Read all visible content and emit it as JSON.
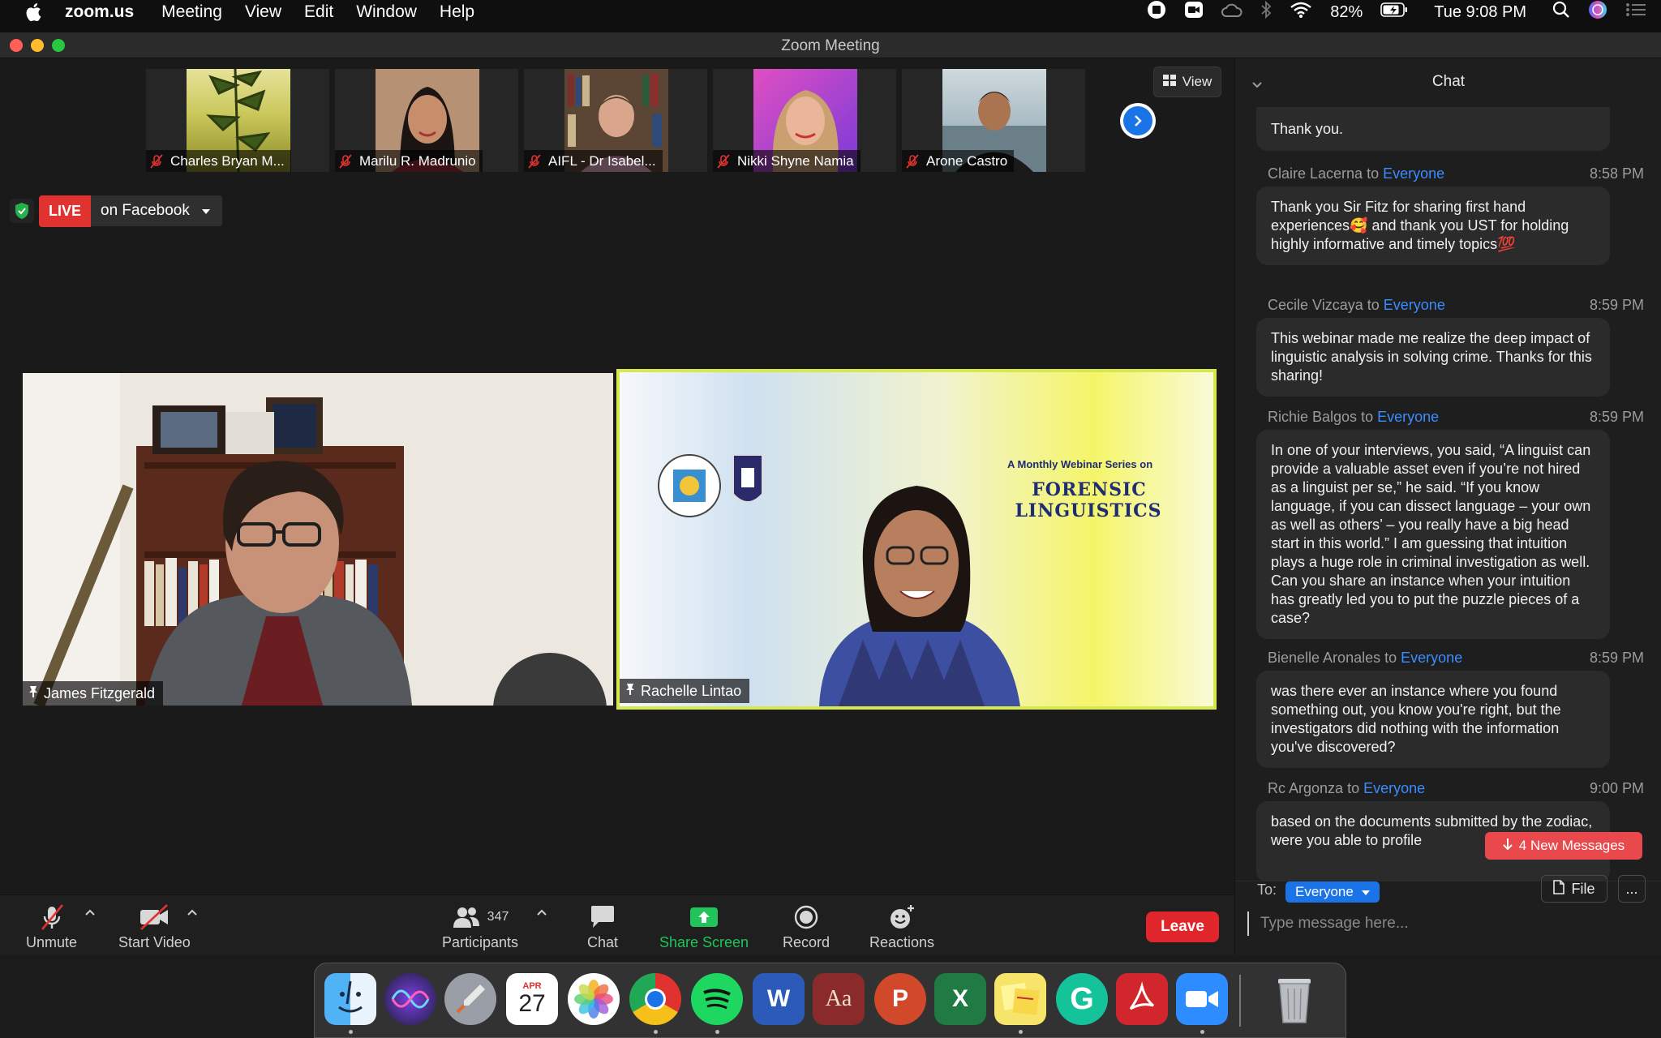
{
  "menubar": {
    "app": "zoom.us",
    "items": [
      "Meeting",
      "View",
      "Edit",
      "Window",
      "Help"
    ],
    "battery": "82%",
    "clock": "Tue 9:08 PM"
  },
  "window": {
    "title": "Zoom Meeting"
  },
  "thumbnails": [
    {
      "name": "Charles Bryan M..."
    },
    {
      "name": "Marilu R. Madrunio"
    },
    {
      "name": "AIFL - Dr Isabel..."
    },
    {
      "name": "Nikki Shyne Namia"
    },
    {
      "name": "Arone Castro"
    }
  ],
  "view_button": "View",
  "live": {
    "badge": "LIVE",
    "label": "on Facebook"
  },
  "videos": {
    "left_name": "James Fitzgerald",
    "right_name": "Rachelle Lintao",
    "slide_line1": "A Monthly Webinar Series on",
    "slide_line2": "FORENSIC",
    "slide_line3": "LINGUISTICS"
  },
  "toolbar": {
    "unmute": "Unmute",
    "start_video": "Start Video",
    "participants": "Participants",
    "participants_count": "347",
    "chat": "Chat",
    "share_screen": "Share Screen",
    "record": "Record",
    "reactions": "Reactions",
    "leave": "Leave"
  },
  "chat": {
    "title": "Chat",
    "to_word": "to",
    "messages": [
      {
        "text": "Thank you."
      },
      {
        "sender": "Claire Lacerna",
        "recipient": "Everyone",
        "time": "8:58 PM",
        "text": "Thank you Sir Fitz for sharing first hand experiences🥰 and thank you UST for holding highly informative and timely topics💯"
      },
      {
        "sender": "Cecile Vizcaya",
        "recipient": "Everyone",
        "time": "8:59 PM",
        "text": "This webinar made me realize the deep impact of linguistic analysis in solving crime. Thanks for this sharing!"
      },
      {
        "sender": "Richie Balgos",
        "recipient": "Everyone",
        "time": "8:59 PM",
        "text": "In one of your interviews, you said, “A linguist can provide a valuable asset even if you’re not hired as a linguist per se,” he said. “If you know language, if you can dissect language – your own as well as others’ – you really have a big head start in this world.” I am guessing that intuition plays a huge role in criminal investigation as well. Can you share an instance when your intuition has greatly led you to put the puzzle pieces of a case?"
      },
      {
        "sender": "Bienelle Aronales",
        "recipient": "Everyone",
        "time": "8:59 PM",
        "text": "was there ever an instance where you found something out, you know you're right, but the investigators did nothing with the information you've discovered?"
      },
      {
        "sender": "Rc Argonza",
        "recipient": "Everyone",
        "time": "9:00 PM",
        "text": "based on the documents submitted by the zodiac, were you able to profile"
      }
    ],
    "new_messages": "4 New Messages",
    "to_label": "To:",
    "to_value": "Everyone",
    "file_button": "File",
    "more_button": "...",
    "input_placeholder": "Type message here..."
  },
  "dock": {
    "calendar_month": "APR",
    "calendar_day": "27"
  },
  "colors": {
    "accent_blue": "#1b73e8",
    "leave_red": "#e0262b",
    "live_red": "#e0322f",
    "share_green": "#21c45a",
    "everyone_blue": "#3b8cff"
  }
}
